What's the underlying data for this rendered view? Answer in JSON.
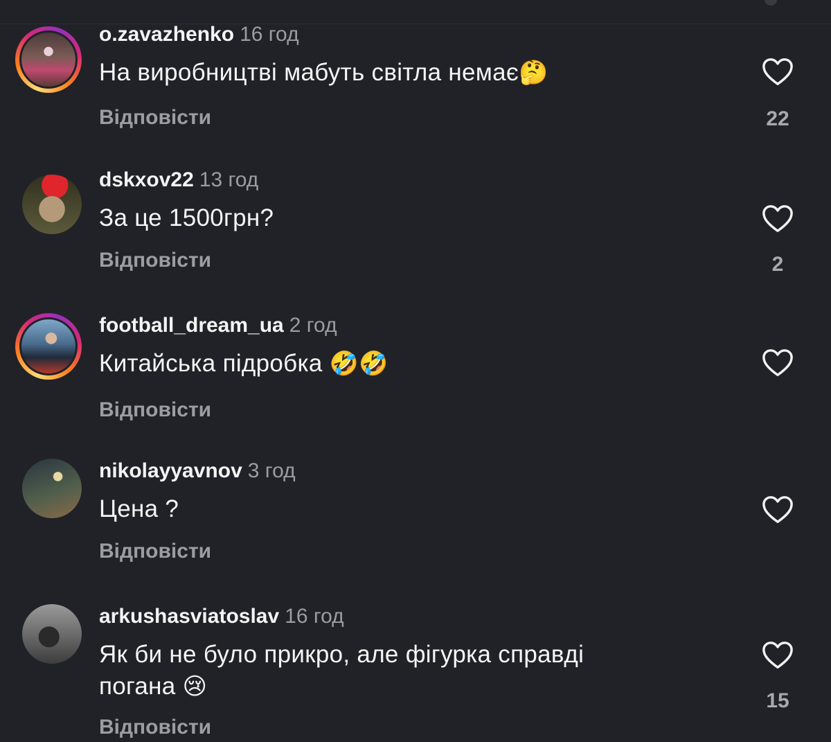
{
  "reply_label": "Відповісти",
  "comments": [
    {
      "username": "o.zavazhenko",
      "time": "16 год",
      "text": "На виробництві мабуть світла немає",
      "emoji": "🤔",
      "likes": "22",
      "has_story_ring": true
    },
    {
      "username": "dskxov22",
      "time": "13 год",
      "text": "За це 1500грн?",
      "emoji": "",
      "likes": "2",
      "has_story_ring": false
    },
    {
      "username": "football_dream_ua",
      "time": "2 год",
      "text": "Китайська підробка",
      "emoji": "🤣🤣",
      "likes": "",
      "has_story_ring": true
    },
    {
      "username": "nikolayyavnov",
      "time": "3 год",
      "text": "Цена ?",
      "emoji": "",
      "likes": "",
      "has_story_ring": false
    },
    {
      "username": "arkushasviatoslav",
      "time": "16 год",
      "text": "Як би не було прикро, але фігурка справді погана",
      "emoji": "😢",
      "likes": "15",
      "has_story_ring": false
    }
  ],
  "colors": {
    "background": "#212227",
    "secondary_text": "#9c9da3",
    "primary_text": "#f5f5f5"
  }
}
